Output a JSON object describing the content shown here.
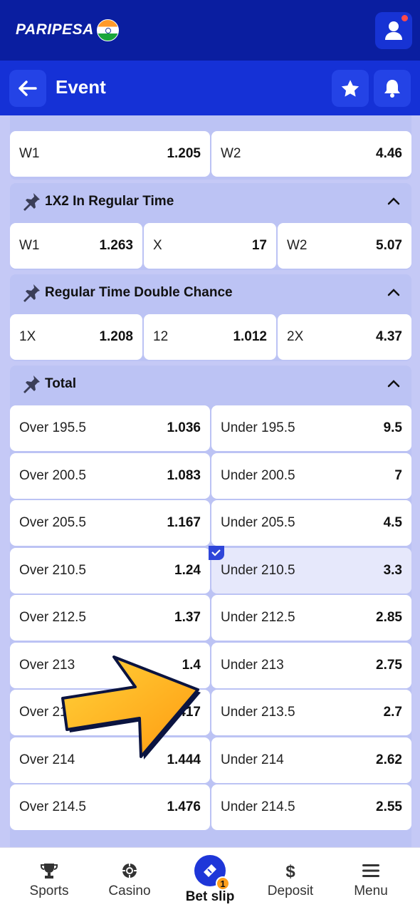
{
  "brand": {
    "logo_text": "PARIPESA",
    "flag": "india-flag"
  },
  "header": {
    "title": "Event",
    "back_icon": "arrow-left-icon",
    "favorite_icon": "star-icon",
    "notify_icon": "bell-icon",
    "profile_icon": "user-icon"
  },
  "top_market": {
    "cells": [
      {
        "label": "W1",
        "odd": "1.205"
      },
      {
        "label": "W2",
        "odd": "4.46"
      }
    ]
  },
  "markets": [
    {
      "title": "1X2 In Regular Time",
      "cells": [
        {
          "label": "W1",
          "odd": "1.263"
        },
        {
          "label": "X",
          "odd": "17"
        },
        {
          "label": "W2",
          "odd": "5.07"
        }
      ]
    },
    {
      "title": "Regular Time Double Chance",
      "cells": [
        {
          "label": "1X",
          "odd": "1.208"
        },
        {
          "label": "12",
          "odd": "1.012"
        },
        {
          "label": "2X",
          "odd": "4.37"
        }
      ]
    },
    {
      "title": "Total",
      "rows": [
        {
          "over": {
            "label": "Over 195.5",
            "odd": "1.036"
          },
          "under": {
            "label": "Under 195.5",
            "odd": "9.5"
          }
        },
        {
          "over": {
            "label": "Over 200.5",
            "odd": "1.083"
          },
          "under": {
            "label": "Under 200.5",
            "odd": "7"
          }
        },
        {
          "over": {
            "label": "Over 205.5",
            "odd": "1.167"
          },
          "under": {
            "label": "Under 205.5",
            "odd": "4.5"
          }
        },
        {
          "over": {
            "label": "Over 210.5",
            "odd": "1.24"
          },
          "under": {
            "label": "Under 210.5",
            "odd": "3.3",
            "selected": true
          }
        },
        {
          "over": {
            "label": "Over 212.5",
            "odd": "1.37"
          },
          "under": {
            "label": "Under 212.5",
            "odd": "2.85"
          }
        },
        {
          "over": {
            "label": "Over 213",
            "odd": "1.4"
          },
          "under": {
            "label": "Under 213",
            "odd": "2.75"
          }
        },
        {
          "over": {
            "label": "Over 213.5",
            "odd": "1.417"
          },
          "under": {
            "label": "Under 213.5",
            "odd": "2.7"
          }
        },
        {
          "over": {
            "label": "Over 214",
            "odd": "1.444"
          },
          "under": {
            "label": "Under 214",
            "odd": "2.62"
          }
        },
        {
          "over": {
            "label": "Over 214.5",
            "odd": "1.476"
          },
          "under": {
            "label": "Under 214.5",
            "odd": "2.55"
          }
        }
      ]
    }
  ],
  "nav": {
    "items": [
      {
        "label": "Sports",
        "icon": "trophy-icon"
      },
      {
        "label": "Casino",
        "icon": "casino-chip-icon"
      },
      {
        "label": "Bet slip",
        "icon": "ticket-icon",
        "badge": "1"
      },
      {
        "label": "Deposit",
        "icon": "dollar-icon"
      },
      {
        "label": "Menu",
        "icon": "menu-icon"
      }
    ]
  },
  "colors": {
    "header_bg": "#0a1ea0",
    "eventbar_bg": "#1531d6",
    "section_bg": "#bcc3f4",
    "selected_bg": "#e6e8fb",
    "accent": "#ff9f1c"
  }
}
